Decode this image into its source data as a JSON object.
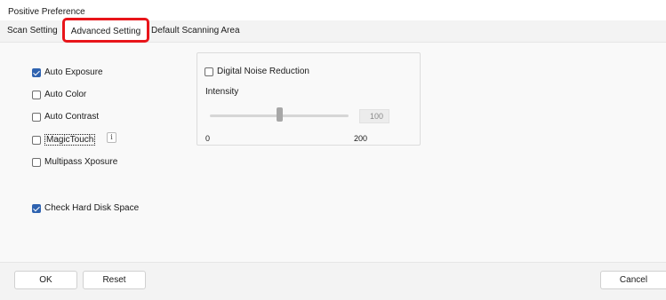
{
  "window": {
    "title": "Positive Preference"
  },
  "tabs": [
    {
      "label": "Scan Setting",
      "selected": false
    },
    {
      "label": "Advanced Setting",
      "selected": true
    },
    {
      "label": "Default Scanning Area",
      "selected": false
    }
  ],
  "options": {
    "auto_exposure": {
      "label": "Auto Exposure",
      "checked": true
    },
    "auto_color": {
      "label": "Auto Color",
      "checked": false
    },
    "auto_contrast": {
      "label": "Auto Contrast",
      "checked": false
    },
    "magictouch": {
      "label": "MagicTouch",
      "checked": false,
      "info_glyph": "i"
    },
    "multipass": {
      "label": "Multipass Xposure",
      "checked": false
    },
    "check_disk": {
      "label": "Check Hard Disk Space",
      "checked": true
    }
  },
  "noise_reduction": {
    "label": "Digital Noise Reduction",
    "checked": false,
    "intensity_label": "Intensity",
    "value": "100",
    "min": "0",
    "max": "200",
    "slider_value": 100,
    "slider_min": 0,
    "slider_max": 200
  },
  "buttons": {
    "ok": "OK",
    "reset": "Reset",
    "cancel": "Cancel"
  },
  "colors": {
    "highlight_border": "#e8151a",
    "checkbox_accent": "#2f63b0"
  },
  "icons": {
    "info": "info-icon"
  }
}
